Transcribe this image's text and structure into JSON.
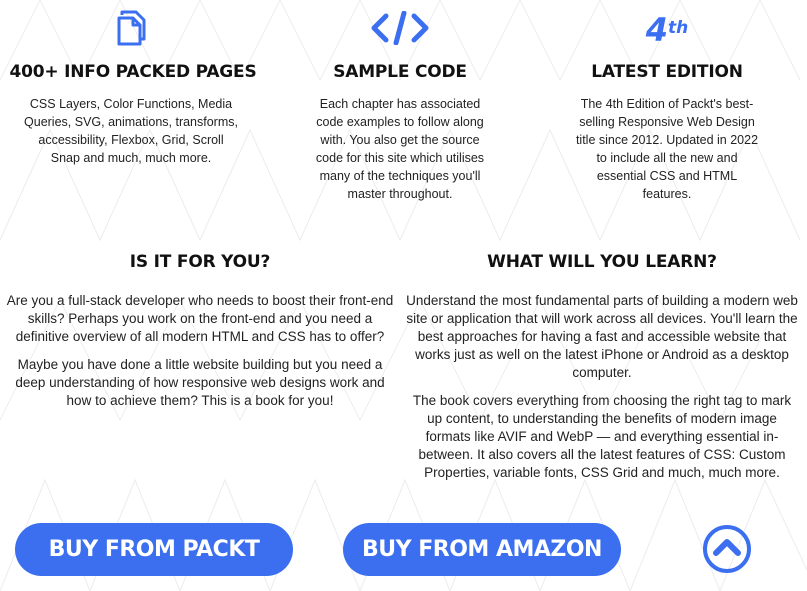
{
  "features": [
    {
      "icon": "document-copy-icon",
      "title": "400+ INFO PACKED PAGES",
      "text": "CSS Layers, Color Functions, Media Queries, SVG, animations, transforms, accessibility, Flexbox, Grid, Scroll Snap and much, much more."
    },
    {
      "icon": "code-icon",
      "title": "SAMPLE CODE",
      "text": "Each chapter has associated code examples to follow along with. You also get the source code for this site which utilises many of the techniques you'll master throughout."
    },
    {
      "icon": "fourth-edition-icon",
      "icon_text": "4",
      "icon_sup": "th",
      "title": "LATEST EDITION",
      "text": "The 4th Edition of Packt's best-selling Responsive Web Design title since 2012. Updated in 2022 to include all the new and essential CSS and HTML features."
    }
  ],
  "sections": {
    "for_you": {
      "title": "IS IT FOR YOU?",
      "p1": "Are you a full-stack developer who needs to boost their front-end skills? Perhaps you work on the front-end and you need a definitive overview of all modern HTML and CSS has to offer?",
      "p2": "Maybe you have done a little website building but you need a deep understanding of how responsive web designs work and how to achieve them? This is a book for you!"
    },
    "learn": {
      "title": "WHAT WILL YOU LEARN?",
      "p1": "Understand the most fundamental parts of building a modern web site or application that will work across all devices. You'll learn the best approaches for having a fast and accessible website that works just as well on the latest iPhone or Android as a desktop computer.",
      "p2": "The book covers everything from choosing the right tag to mark up content, to understanding the benefits of modern image formats like AVIF and WebP — and everything essential in-between. It also covers all the latest features of CSS: Custom Properties, variable fonts, CSS Grid and much, much more."
    }
  },
  "buttons": {
    "packt": "BUY FROM PACKT",
    "amazon": "BUY FROM AMAZON",
    "scroll_top_icon": "chevron-up-circle-icon"
  },
  "colors": {
    "accent": "#3b6ff0",
    "text": "#111111",
    "background": "#ffffff"
  }
}
